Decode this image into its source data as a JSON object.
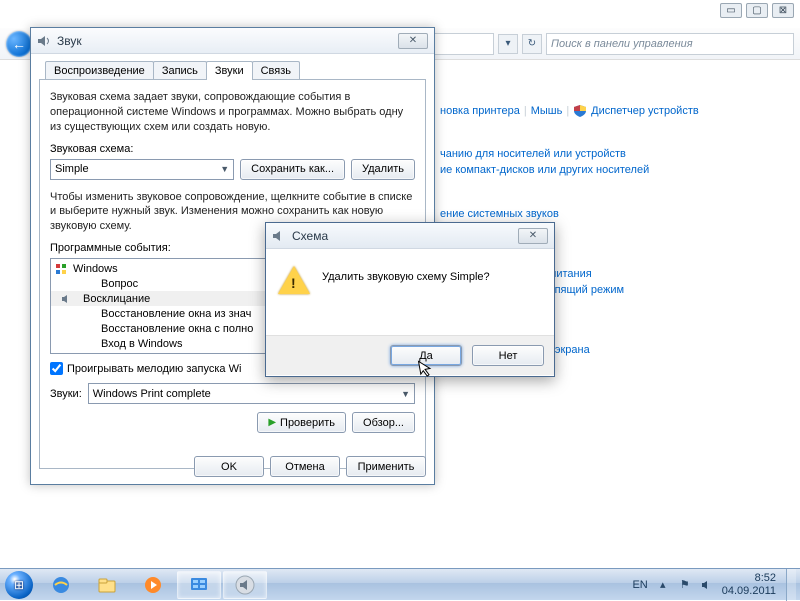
{
  "title_buttons": {
    "min": "▭",
    "max": "▢",
    "close": "⊠"
  },
  "nav": {
    "search_placeholder": "Поиск в панели управления",
    "refresh": "↻",
    "dd": "▾"
  },
  "control_panel": {
    "r1a": "новка принтера",
    "r1b": "Мышь",
    "r1c": "Диспетчер устройств",
    "r2a": "чанию для носителей или устройств",
    "r2b": "ие компакт-дисков или других носителей",
    "r3a": "ение системных звуков",
    "r4a": "ойка функций кнопок питания",
    "r4b": "астройка перехода в спящий режим",
    "r5a": "астройка разрешения экрана"
  },
  "sound": {
    "title": "Звук",
    "tabs": [
      "Воспроизведение",
      "Запись",
      "Звуки",
      "Связь"
    ],
    "active_tab": 2,
    "desc": "Звуковая схема задает звуки, сопровождающие события в операционной системе Windows и программах. Можно выбрать одну из существующих схем или создать новую.",
    "scheme_label": "Звуковая схема:",
    "scheme_value": "Simple",
    "save_as": "Сохранить как...",
    "delete": "Удалить",
    "hint": "Чтобы изменить звуковое сопровождение, щелкните событие в списке и выберите нужный звук. Изменения можно сохранить как новую звуковую схему.",
    "events_label": "Программные события:",
    "events": [
      {
        "label": "Windows",
        "root": true
      },
      {
        "label": "Вопрос"
      },
      {
        "label": "Восклицание",
        "icon": true,
        "sel": true
      },
      {
        "label": "Восстановление окна из знач"
      },
      {
        "label": "Восстановление окна с полно"
      },
      {
        "label": "Вход в Windows"
      }
    ],
    "play_startup": "Проигрывать мелодию запуска Wi",
    "sounds_label": "Звуки:",
    "sound_value": "Windows Print complete",
    "test": "Проверить",
    "browse": "Обзор...",
    "ok": "OK",
    "cancel": "Отмена",
    "apply": "Применить"
  },
  "confirm": {
    "title": "Схема",
    "text": "Удалить звуковую схему Simple?",
    "yes": "Да",
    "no": "Нет"
  },
  "taskbar": {
    "lang": "EN",
    "time": "8:52",
    "date": "04.09.2011"
  }
}
